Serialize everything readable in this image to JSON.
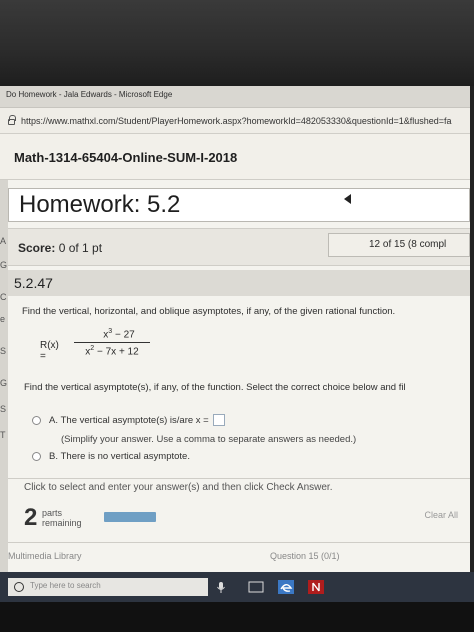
{
  "window": {
    "title": "Do Homework - Jala Edwards - Microsoft Edge",
    "url": "https://www.mathxl.com/Student/PlayerHomework.aspx?homeworkId=482053330&questionId=1&flushed=fa"
  },
  "course": {
    "name": "Math-1314-65404-Online-SUM-I-2018"
  },
  "homework": {
    "title": "Homework: 5.2"
  },
  "score": {
    "label": "Score:",
    "value": "0 of 1 pt"
  },
  "navigation": {
    "position": "12 of 15 (8 compl"
  },
  "question": {
    "number": "5.2.47",
    "instruction": "Find the vertical, horizontal, and oblique asymptotes, if any, of the given rational function.",
    "function_label": "R(x) =",
    "numerator_base": "x",
    "numerator_exp": "3",
    "numerator_rest": " − 27",
    "denominator_base": "x",
    "denominator_exp": "2",
    "denominator_rest": " − 7x + 12",
    "subquestion": "Find the vertical asymptote(s), if any, of the function. Select the correct choice below and fil",
    "choice_a_letter": "A.",
    "choice_a_text": "The vertical asymptote(s) is/are x =",
    "choice_a_hint": "(Simplify your answer. Use a comma to separate answers as needed.)",
    "choice_b_letter": "B.",
    "choice_b_text": "There is no vertical asymptote."
  },
  "status": {
    "click_message": "Click to select and enter your answer(s) and then click Check Answer.",
    "parts_count": "2",
    "parts_word": "parts",
    "remaining_word": "remaining",
    "clear_all": "Clear All"
  },
  "footer": {
    "multimedia_library": "Multimedia Library",
    "question_info": "Question 15 (0/1)"
  },
  "left_strip_letters": [
    "A",
    "G",
    "C",
    "e",
    "S",
    "G",
    "S",
    "T"
  ],
  "taskbar": {
    "search_placeholder": "Type here to search"
  },
  "colors": {
    "progress_bar": "#6f9fc4",
    "taskbar": "#2d3440"
  }
}
